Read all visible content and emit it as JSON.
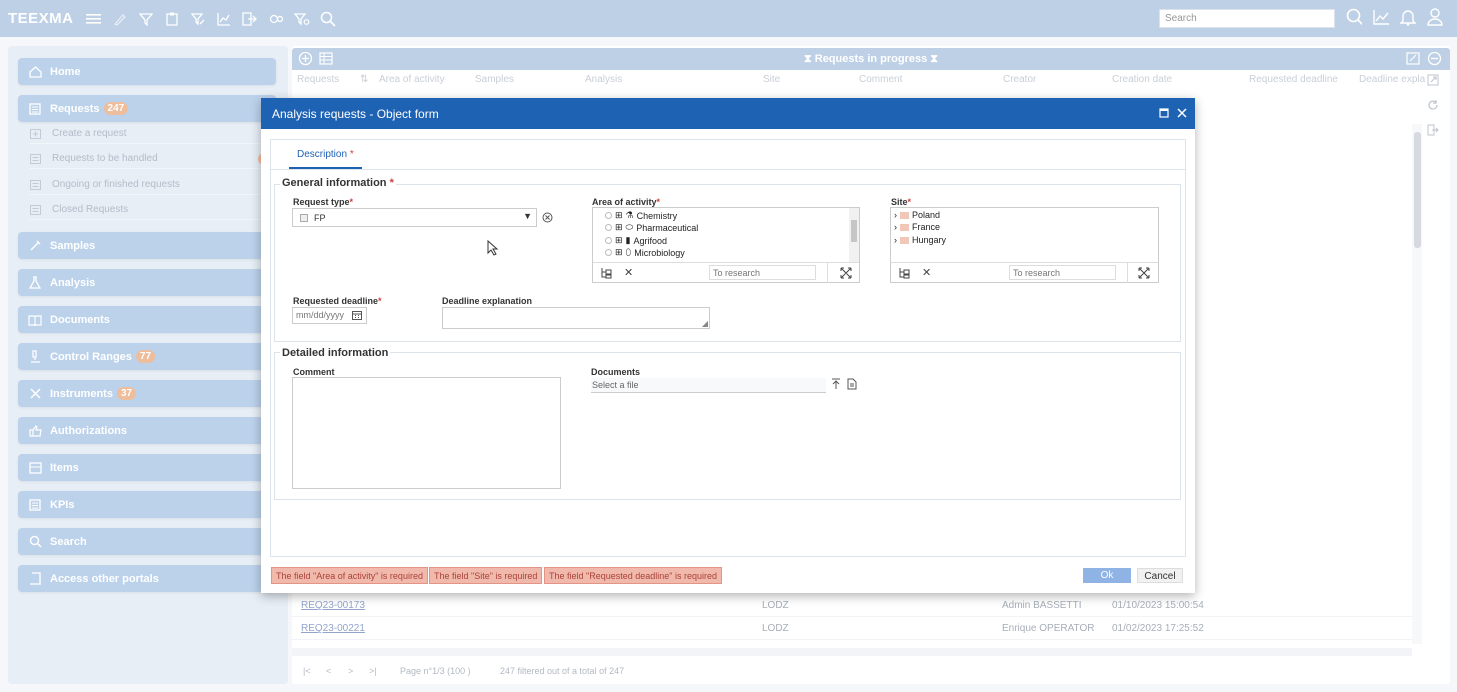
{
  "app": {
    "logo": "TEEXMA"
  },
  "topbar": {
    "search_placeholder": "Search"
  },
  "sidebar": {
    "home": "Home",
    "requests": {
      "label": "Requests",
      "badge": "247"
    },
    "sub_items": [
      "Create a request",
      "Requests to be handled",
      "Ongoing or finished requests",
      "Closed Requests"
    ],
    "samples": "Samples",
    "analysis": "Analysis",
    "documents": "Documents",
    "control_ranges": {
      "label": "Control Ranges",
      "badge": "77"
    },
    "instruments": {
      "label": "Instruments",
      "badge": "37"
    },
    "authorizations": "Authorizations",
    "items": "Items",
    "kpis": "KPIs",
    "search": "Search",
    "access_other_portals": "Access other portals"
  },
  "main": {
    "title": "⧗ Requests in progress ⧗",
    "columns": [
      "Requests",
      "Area of activity",
      "Samples",
      "Analysis",
      "Site",
      "Comment",
      "Creator",
      "Creation date",
      "Requested deadline",
      "Deadline expla"
    ],
    "rows": [
      {
        "id": "REQ23-00173",
        "site": "LODZ",
        "creator": "Admin BASSETTI",
        "date": "01/10/2023 15:00:54"
      },
      {
        "id": "REQ23-00221",
        "site": "LODZ",
        "creator": "Enrique OPERATOR",
        "date": "01/02/2023 17:25:52"
      }
    ],
    "pager": {
      "page": "Page n°1/3 (100 )",
      "summary": "247 filtered out of a total of 247"
    }
  },
  "modal": {
    "title": "Analysis requests - Object form",
    "tab": "Description",
    "general_title": "General information",
    "request_type_label": "Request type",
    "request_type_value": "FP",
    "area_label": "Area of activity",
    "areas": [
      "Chemistry",
      "Pharmaceutical",
      "Agrifood",
      "Microbiology"
    ],
    "site_label": "Site",
    "sites": [
      "Poland",
      "France",
      "Hungary"
    ],
    "research_placeholder": "To research",
    "deadline_label": "Requested deadline",
    "deadline_placeholder": "mm/dd/yyyy",
    "deadline_expl_label": "Deadline explanation",
    "detailed_title": "Detailed information",
    "comment_label": "Comment",
    "documents_label": "Documents",
    "documents_placeholder": "Select a file",
    "errors": [
      "The field \"Area of activity\" is required",
      "The field \"Site\" is required",
      "The field \"Requested deadline\" is required"
    ],
    "ok": "Ok",
    "cancel": "Cancel",
    "required_mark": "*"
  }
}
